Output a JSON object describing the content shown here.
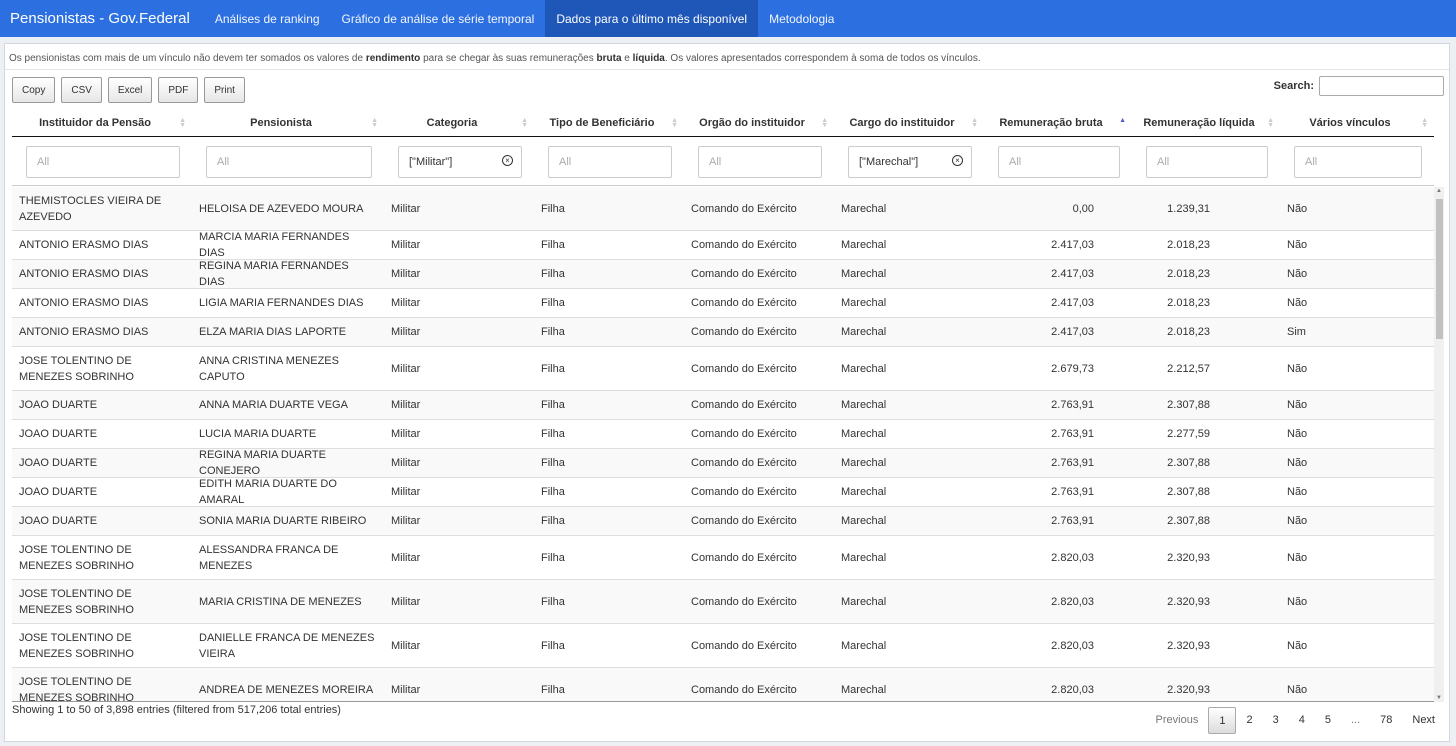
{
  "navbar": {
    "brand": "Pensionistas - Gov.Federal",
    "tabs": [
      {
        "label": "Análises de ranking"
      },
      {
        "label": "Gráfico de análise de série temporal"
      },
      {
        "label": "Dados para o último mês disponível"
      },
      {
        "label": "Metodologia"
      }
    ]
  },
  "note": {
    "p1": "Os pensionistas com mais de um vínculo não devem ter somados os valores de ",
    "b1": "rendimento",
    "p2": " para se chegar às suas remunerações ",
    "b2": "bruta",
    "p3": " e ",
    "b3": "líquida",
    "p4": ". Os valores apresentados correspondem à soma de todos os vínculos."
  },
  "buttons": [
    "Copy",
    "CSV",
    "Excel",
    "PDF",
    "Print"
  ],
  "search": {
    "label": "Search:",
    "value": ""
  },
  "columns": [
    "Instituidor da Pensão",
    "Pensionista",
    "Categoria",
    "Tipo de Beneficiário",
    "Orgão do instituidor",
    "Cargo do instituidor",
    "Remuneração bruta",
    "Remuneração líquida",
    "Vários vínculos"
  ],
  "filters": [
    "All",
    "All",
    "[\"Militar\"]",
    "All",
    "All",
    "[\"Marechal\"]",
    "All",
    "All",
    "All"
  ],
  "rows": [
    [
      "THEMISTOCLES VIEIRA DE AZEVEDO",
      "HELOISA DE AZEVEDO MOURA",
      "Militar",
      "Filha",
      "Comando do Exército",
      "Marechal",
      "0,00",
      "1.239,31",
      "Não"
    ],
    [
      "ANTONIO ERASMO DIAS",
      "MARCIA MARIA FERNANDES DIAS",
      "Militar",
      "Filha",
      "Comando do Exército",
      "Marechal",
      "2.417,03",
      "2.018,23",
      "Não"
    ],
    [
      "ANTONIO ERASMO DIAS",
      "REGINA MARIA FERNANDES DIAS",
      "Militar",
      "Filha",
      "Comando do Exército",
      "Marechal",
      "2.417,03",
      "2.018,23",
      "Não"
    ],
    [
      "ANTONIO ERASMO DIAS",
      "LIGIA MARIA FERNANDES DIAS",
      "Militar",
      "Filha",
      "Comando do Exército",
      "Marechal",
      "2.417,03",
      "2.018,23",
      "Não"
    ],
    [
      "ANTONIO ERASMO DIAS",
      "ELZA MARIA DIAS LAPORTE",
      "Militar",
      "Filha",
      "Comando do Exército",
      "Marechal",
      "2.417,03",
      "2.018,23",
      "Sim"
    ],
    [
      "JOSE TOLENTINO DE MENEZES SOBRINHO",
      "ANNA CRISTINA MENEZES CAPUTO",
      "Militar",
      "Filha",
      "Comando do Exército",
      "Marechal",
      "2.679,73",
      "2.212,57",
      "Não"
    ],
    [
      "JOAO DUARTE",
      "ANNA MARIA DUARTE VEGA",
      "Militar",
      "Filha",
      "Comando do Exército",
      "Marechal",
      "2.763,91",
      "2.307,88",
      "Não"
    ],
    [
      "JOAO DUARTE",
      "LUCIA MARIA DUARTE",
      "Militar",
      "Filha",
      "Comando do Exército",
      "Marechal",
      "2.763,91",
      "2.277,59",
      "Não"
    ],
    [
      "JOAO DUARTE",
      "REGINA MARIA DUARTE CONEJERO",
      "Militar",
      "Filha",
      "Comando do Exército",
      "Marechal",
      "2.763,91",
      "2.307,88",
      "Não"
    ],
    [
      "JOAO DUARTE",
      "EDITH MARIA DUARTE DO AMARAL",
      "Militar",
      "Filha",
      "Comando do Exército",
      "Marechal",
      "2.763,91",
      "2.307,88",
      "Não"
    ],
    [
      "JOAO DUARTE",
      "SONIA MARIA DUARTE RIBEIRO",
      "Militar",
      "Filha",
      "Comando do Exército",
      "Marechal",
      "2.763,91",
      "2.307,88",
      "Não"
    ],
    [
      "JOSE TOLENTINO DE MENEZES SOBRINHO",
      "ALESSANDRA FRANCA DE MENEZES",
      "Militar",
      "Filha",
      "Comando do Exército",
      "Marechal",
      "2.820,03",
      "2.320,93",
      "Não"
    ],
    [
      "JOSE TOLENTINO DE MENEZES SOBRINHO",
      "MARIA CRISTINA DE MENEZES",
      "Militar",
      "Filha",
      "Comando do Exército",
      "Marechal",
      "2.820,03",
      "2.320,93",
      "Não"
    ],
    [
      "JOSE TOLENTINO DE MENEZES SOBRINHO",
      "DANIELLE FRANCA DE MENEZES VIEIRA",
      "Militar",
      "Filha",
      "Comando do Exército",
      "Marechal",
      "2.820,03",
      "2.320,93",
      "Não"
    ],
    [
      "JOSE TOLENTINO DE MENEZES SOBRINHO",
      "ANDREA DE MENEZES MOREIRA",
      "Militar",
      "Filha",
      "Comando do Exército",
      "Marechal",
      "2.820,03",
      "2.320,93",
      "Não"
    ]
  ],
  "info": "Showing 1 to 50 of 3,898 entries (filtered from 517,206 total entries)",
  "pagination": [
    "Previous",
    "1",
    "2",
    "3",
    "4",
    "5",
    "...",
    "78",
    "Next"
  ]
}
